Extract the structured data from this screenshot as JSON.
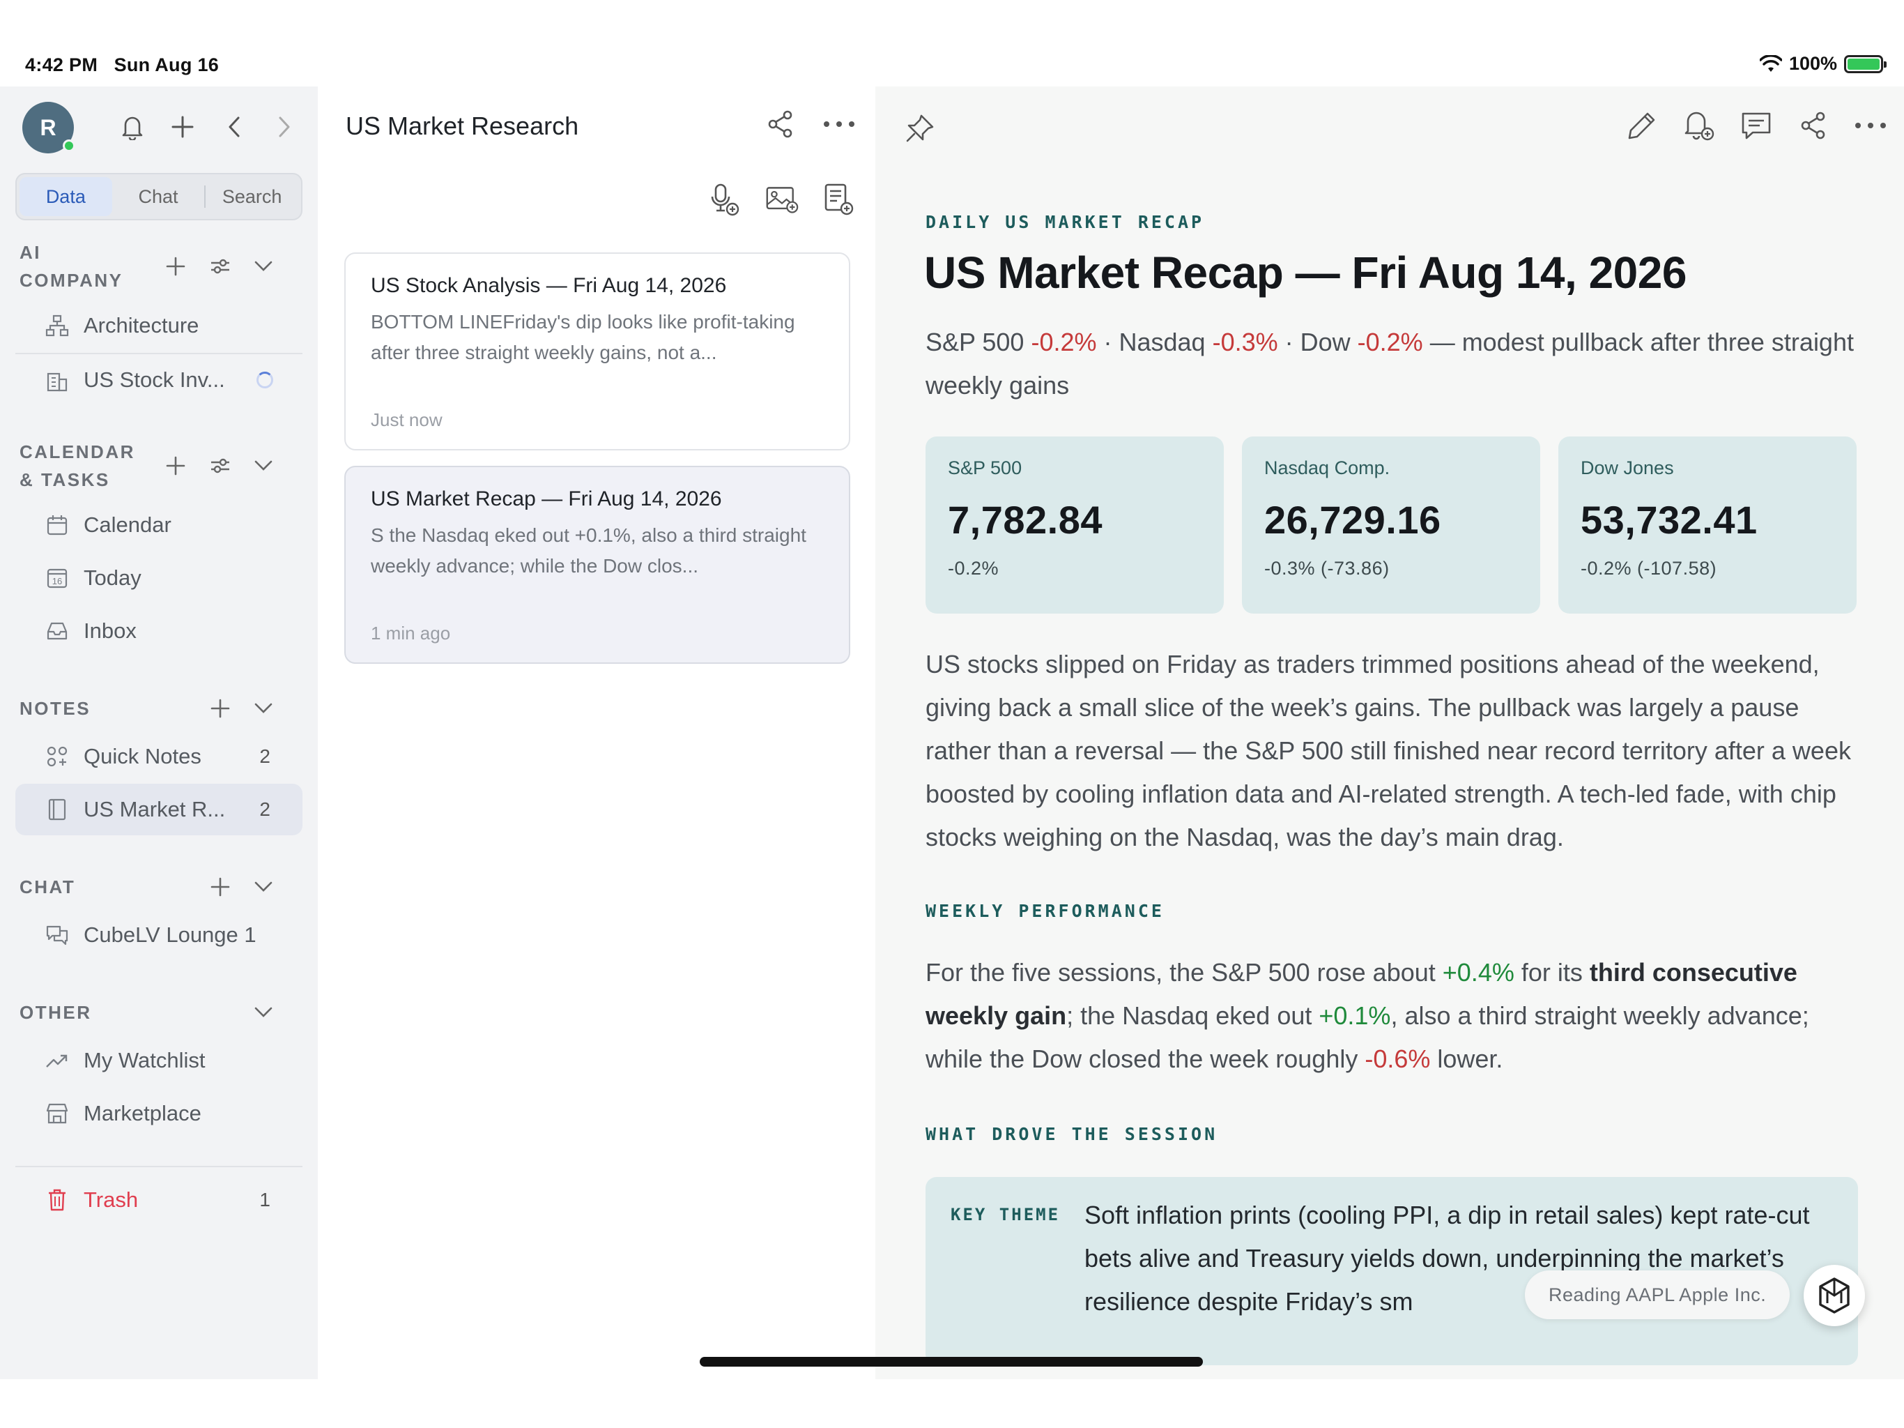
{
  "status_bar": {
    "time": "4:42 PM",
    "date": "Sun Aug 16",
    "battery": "100%"
  },
  "sidebar": {
    "avatar_initial": "R",
    "tabs": [
      {
        "label": "Data",
        "active": true
      },
      {
        "label": "Chat",
        "active": false
      },
      {
        "label": "Search",
        "active": false
      }
    ],
    "sections": {
      "ai_company": {
        "title_line1": "AI",
        "title_line2": "COMPANY",
        "items": [
          {
            "label": "Architecture",
            "icon": "hierarchy-icon"
          },
          {
            "label": "US Stock Inv...",
            "icon": "building-icon",
            "loading": true
          }
        ]
      },
      "calendar": {
        "title_line1": "CALENDAR",
        "title_line2": "& TASKS",
        "items": [
          {
            "label": "Calendar",
            "icon": "calendar-icon"
          },
          {
            "label": "Today",
            "icon": "calendar-day-icon",
            "day": "16"
          },
          {
            "label": "Inbox",
            "icon": "inbox-icon"
          }
        ]
      },
      "notes": {
        "title": "NOTES",
        "items": [
          {
            "label": "Quick Notes",
            "icon": "grid-nodes-icon",
            "count": "2"
          },
          {
            "label": "US Market R...",
            "icon": "notebook-icon",
            "count": "2",
            "active": true
          }
        ]
      },
      "chat": {
        "title": "CHAT",
        "items": [
          {
            "label": "CubeLV Lounge 1",
            "icon": "chat-bubbles-icon"
          }
        ]
      },
      "other": {
        "title": "OTHER",
        "items": [
          {
            "label": "My Watchlist",
            "icon": "trend-up-icon"
          },
          {
            "label": "Marketplace",
            "icon": "store-icon"
          }
        ]
      }
    },
    "trash": {
      "label": "Trash",
      "count": "1"
    }
  },
  "list": {
    "title": "US Market Research",
    "cards": [
      {
        "title": "US Stock Analysis — Fri Aug 14, 2026",
        "snippet": "BOTTOM LINEFriday's dip looks like profit-taking after three straight weekly gains, not a...",
        "time": "Just now"
      },
      {
        "title": "US Market Recap — Fri Aug 14, 2026",
        "snippet": "S the Nasdaq eked out +0.1%, also a third straight weekly advance; while the Dow clos...",
        "time": "1 min ago"
      }
    ]
  },
  "article": {
    "eyebrow": "DAILY US MARKET RECAP",
    "title": "US Market Recap — Fri Aug 14, 2026",
    "subtitle": {
      "sp_label": "S&P 500 ",
      "sp_change": "-0.2%",
      "nasdaq_label": " · Nasdaq ",
      "nasdaq_change": "-0.3%",
      "dow_label": " · Dow ",
      "dow_change": "-0.2%",
      "tail": " — modest pullback after three straight weekly gains"
    },
    "metrics": [
      {
        "label": "S&P 500",
        "value": "7,782.84",
        "change": "-0.2%"
      },
      {
        "label": "Nasdaq Comp.",
        "value": "26,729.16",
        "change": "-0.3% (-73.86)"
      },
      {
        "label": "Dow Jones",
        "value": "53,732.41",
        "change": "-0.2% (-107.58)"
      }
    ],
    "intro": "US stocks slipped on Friday as traders trimmed positions ahead of the weekend, giving back a small slice of the week’s gains. The pullback was largely a pause rather than a reversal — the S&P 500 still finished near record territory after a week boosted by cooling inflation data and AI-related strength. A tech-led fade, with chip stocks weighing on the Nasdaq, was the day’s main drag.",
    "weekly_heading": "WEEKLY PERFORMANCE",
    "weekly": {
      "p1": "For the five sessions, the S&P 500 rose about ",
      "sp": "+0.4%",
      "p2": " for its ",
      "bold": "third consecutive weekly gain",
      "p3": "; the Nasdaq eked out ",
      "nasdaq": "+0.1%",
      "p4": ", also a third straight weekly advance; while the Dow closed the week roughly ",
      "dow": "-0.6%",
      "p5": " lower."
    },
    "session_heading": "WHAT DROVE THE SESSION",
    "key_theme_label": "KEY THEME",
    "key_theme_text": "Soft inflation prints (cooling PPI, a dip in retail sales) kept rate-cut bets alive and Treasury yields down, underpinning the market’s resilience despite Friday’s sm",
    "reading_status": "Reading AAPL Apple Inc."
  },
  "colors": {
    "accent_teal": "#1d5c5c",
    "negative": "#c53a3a",
    "positive": "#1f8a3b",
    "trash": "#e03e4f"
  }
}
